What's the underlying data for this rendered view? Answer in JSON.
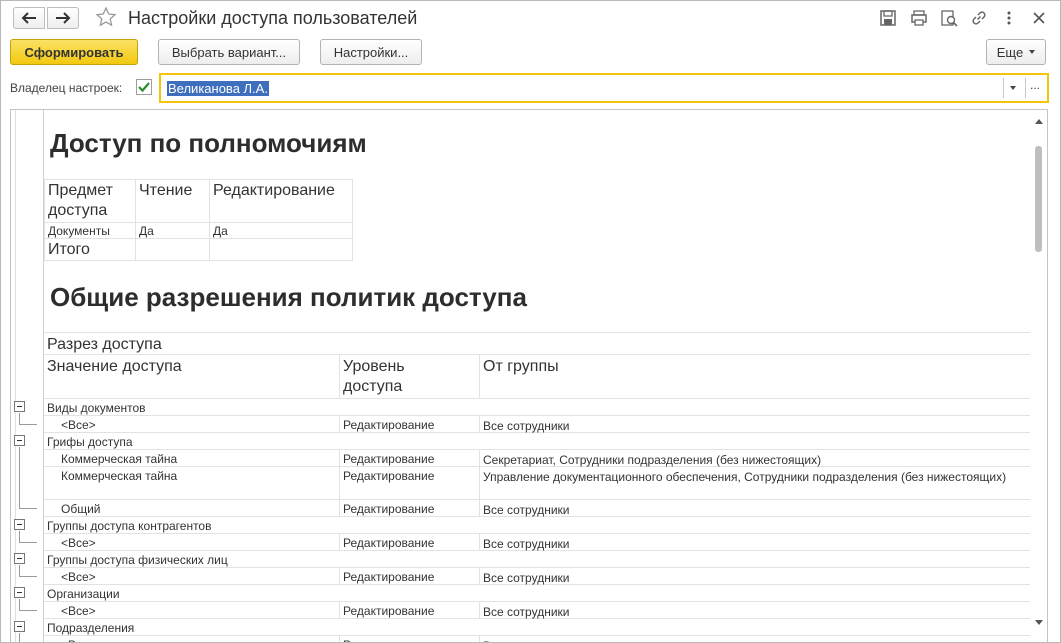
{
  "window": {
    "title": "Настройки доступа пользователей"
  },
  "toolbar": {
    "generate_label": "Сформировать",
    "choose_variant_label": "Выбрать вариант...",
    "settings_label": "Настройки...",
    "more_label": "Еще"
  },
  "owner": {
    "label": "Владелец настроек:",
    "checked": true,
    "value": "Великанова Л.А.",
    "select_button": "..."
  },
  "report": {
    "section1_title": "Доступ по полномочиям",
    "table1": {
      "headers": [
        "Предмет доступа",
        "Чтение",
        "Редактирование"
      ],
      "header_lines": [
        [
          "Предмет",
          "доступа"
        ],
        [
          "Чтение"
        ],
        [
          "Редактирование"
        ]
      ],
      "rows": [
        [
          "Документы",
          "Да",
          "Да"
        ]
      ],
      "total_label": "Итого"
    },
    "section2_title": "Общие разрешения политик доступа",
    "policies": {
      "group_header": "Разрез доступа",
      "headers": [
        "Значение доступа",
        "Уровень доступа",
        "От группы"
      ],
      "header_lines": [
        [
          "Значение доступа"
        ],
        [
          "Уровень",
          "доступа"
        ],
        [
          "От группы"
        ]
      ],
      "groups": [
        {
          "name": "Виды документов",
          "items": [
            {
              "value": "<Все>",
              "level": "Редактирование",
              "from_group": "Все сотрудники"
            }
          ]
        },
        {
          "name": "Грифы доступа",
          "items": [
            {
              "value": "Коммерческая тайна",
              "level": "Редактирование",
              "from_group": "Секретариат, Сотрудники подразделения (без нижестоящих)"
            },
            {
              "value": "Коммерческая тайна",
              "level": "Редактирование",
              "from_group": "Управление документационного обеспечения, Сотрудники подразделения (без нижестоящих)"
            },
            {
              "value": "Общий",
              "level": "Редактирование",
              "from_group": "Все сотрудники"
            }
          ]
        },
        {
          "name": "Группы доступа контрагентов",
          "items": [
            {
              "value": "<Все>",
              "level": "Редактирование",
              "from_group": "Все сотрудники"
            }
          ]
        },
        {
          "name": "Группы доступа физических лиц",
          "items": [
            {
              "value": "<Все>",
              "level": "Редактирование",
              "from_group": "Все сотрудники"
            }
          ]
        },
        {
          "name": "Организации",
          "items": [
            {
              "value": "<Все>",
              "level": "Редактирование",
              "from_group": "Все сотрудники"
            }
          ]
        },
        {
          "name": "Подразделения",
          "items": [
            {
              "value": "<Все>",
              "level": "Редактирование",
              "from_group": "Все сотрудники"
            }
          ]
        }
      ]
    }
  }
}
